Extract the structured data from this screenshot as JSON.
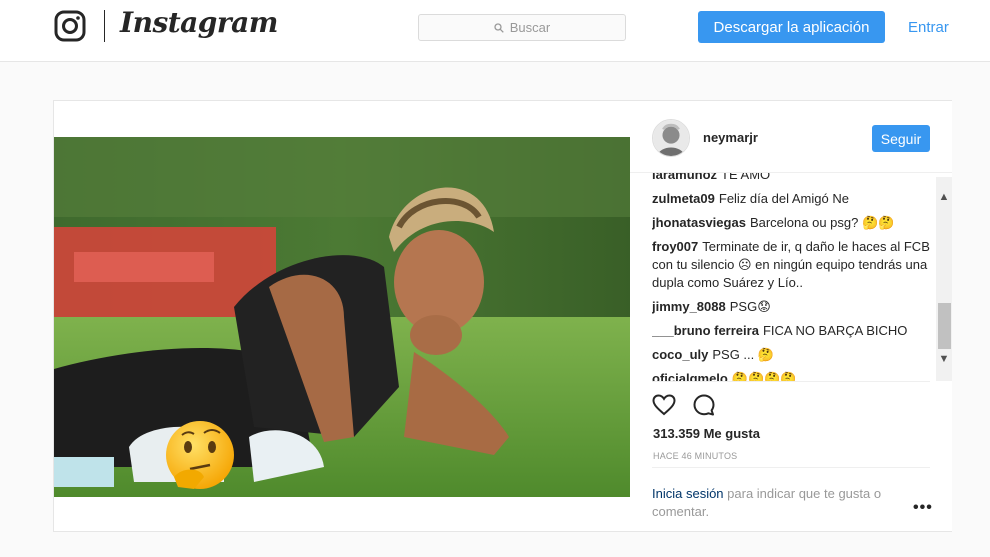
{
  "header": {
    "wordmark": "Instagram",
    "search_placeholder": "Buscar",
    "download_label": "Descargar la aplicación",
    "login_label": "Entrar"
  },
  "post": {
    "username": "neymarjr",
    "follow_label": "Seguir",
    "comments": [
      {
        "user": "laramunoz",
        "text": "TE AMO"
      },
      {
        "user": "zulmeta09",
        "text": "Feliz día del Amigó Ne"
      },
      {
        "user": "jhonatasviegas",
        "text": "Barcelona ou psg? 🤔🤔"
      },
      {
        "user": "froy007",
        "text": "Terminate de ir, q daño le haces al FCB con tu silencio ☹ en ningún equipo tendrás una dupla como Suárez y Lío.."
      },
      {
        "user": "jimmy_8088",
        "text": "PSG😟"
      },
      {
        "user": "___bruno ferreira",
        "text": "FICA NO BARÇA BICHO"
      },
      {
        "user": "coco_uly",
        "text": "PSG ... 🤔"
      },
      {
        "user": "oficialgmelo",
        "text": "🤔🤔🤔🤔"
      }
    ],
    "likes": "313.359 Me gusta",
    "time": "HACE 46 MINUTOS",
    "login_link": "Inicia sesión",
    "login_rest": " para indicar que te gusta o comentar.",
    "more": "•••"
  },
  "colors": {
    "accent": "#3897f0",
    "text": "#262626",
    "muted": "#999999",
    "grass": "#5d9a3a"
  },
  "icons": [
    "instagram-logo-icon",
    "search-icon",
    "heart-icon",
    "comment-icon",
    "thinking-emoji-icon"
  ]
}
